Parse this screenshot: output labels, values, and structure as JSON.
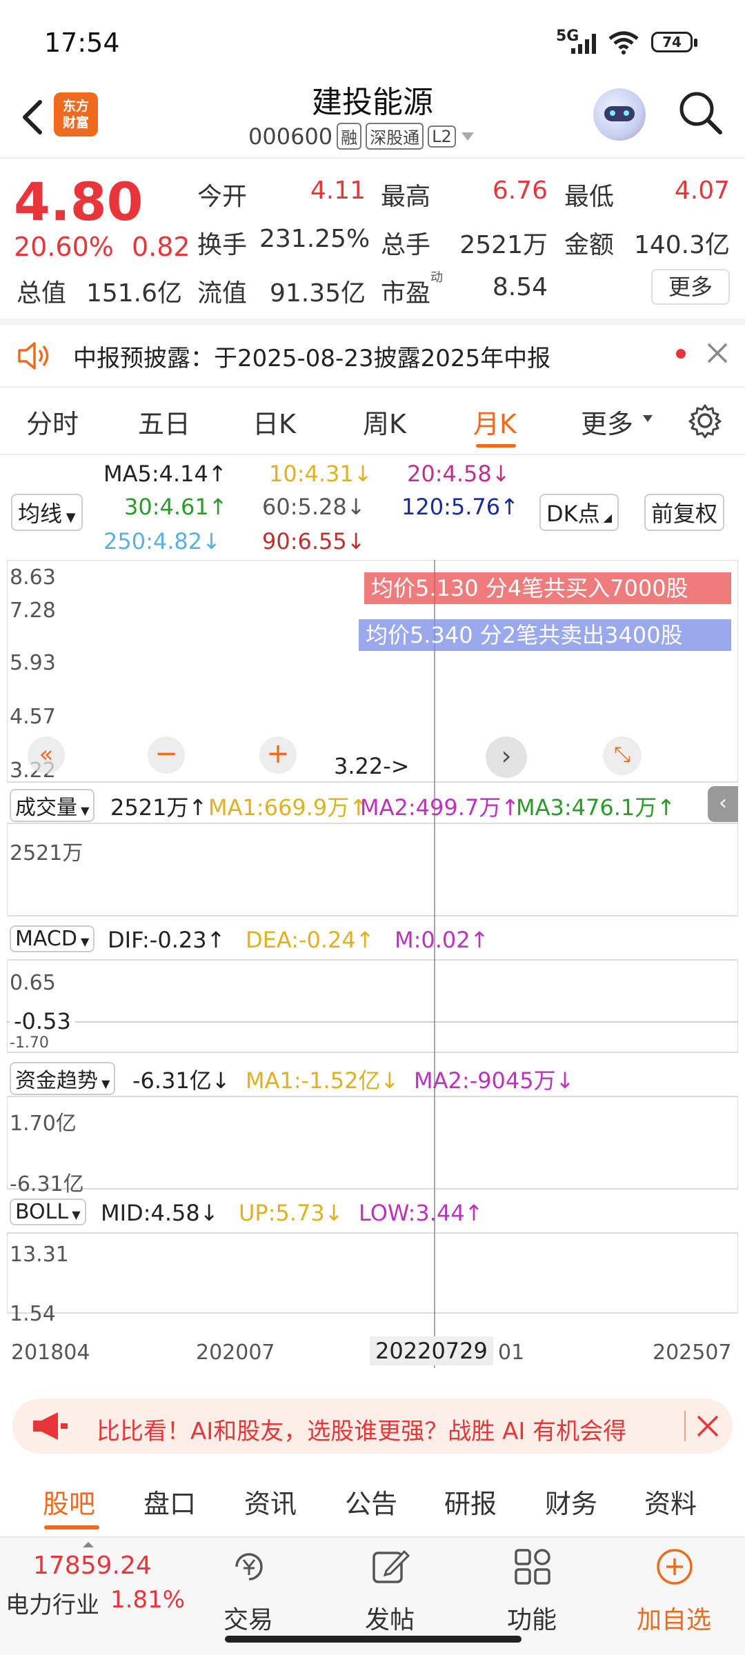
{
  "status_bar": {
    "time": "17:54",
    "network": "5G",
    "battery": "74"
  },
  "header": {
    "back_label": "back",
    "logo_line1": "东方",
    "logo_line2": "财富",
    "title": "建投能源",
    "code": "000600",
    "tags": [
      "融",
      "深股通",
      "L2"
    ]
  },
  "quote": {
    "price": "4.80",
    "change_pct": "20.60%",
    "change_abs": "0.82",
    "rows": [
      [
        {
          "label": "今开",
          "value": "4.11",
          "color": "red"
        },
        {
          "label": "最高",
          "value": "6.76",
          "color": "red"
        },
        {
          "label": "最低",
          "value": "4.07",
          "color": "red"
        }
      ],
      [
        {
          "label": "换手",
          "value": "231.25%",
          "color": "gray"
        },
        {
          "label": "总手",
          "value": "2521万",
          "color": "gray"
        },
        {
          "label": "金额",
          "value": "140.3亿",
          "color": "gray"
        }
      ]
    ],
    "row3": {
      "zongzhi_label": "总值",
      "zongzhi_value": "151.6亿",
      "liuzhi_label": "流值",
      "liuzhi_value": "91.35亿",
      "pe_label": "市盈",
      "pe_sup": "动",
      "pe_value": "8.54"
    },
    "more_label": "更多"
  },
  "notice": {
    "text": "中报预披露：于2025-08-23披露2025年中报"
  },
  "tabs": {
    "items": [
      "分时",
      "五日",
      "日K",
      "周K",
      "月K",
      "更多"
    ],
    "active_index": 4
  },
  "ma_legend": {
    "junxian": "均线",
    "ma5": "MA5:4.14↑",
    "ma10": "10:4.31↓",
    "ma20": "20:4.58↓",
    "ma30": "30:4.61↑",
    "ma60": "60:5.28↓",
    "ma120": "120:5.76↑",
    "ma250": "250:4.82↓",
    "ma90": "90:6.55↓",
    "dk": "DK点",
    "fq": "前复权"
  },
  "chart": {
    "price_labels": [
      "8.63",
      "7.28",
      "5.93",
      "4.57",
      "3.22"
    ],
    "buy_tip": "均价5.130  分4笔共买入7000股",
    "sell_tip": "均价5.340  分2笔共卖出3400股",
    "min_marker": "3.22->",
    "volume": {
      "name": "成交量",
      "value": "2521万↑",
      "ma1": "MA1:669.9万↑",
      "ma2": "MA2:499.7万↑",
      "ma3": "MA3:476.1万↑",
      "scale": "2521万"
    },
    "macd": {
      "name": "MACD",
      "dif": "DIF:-0.23↑",
      "dea": "DEA:-0.24↑",
      "m": "M:0.02↑",
      "top": "0.65",
      "mid": "-0.53",
      "bottom": "-1.70"
    },
    "fund": {
      "name": "资金趋势",
      "value": "-6.31亿↓",
      "ma1": "MA1:-1.52亿↓",
      "ma2": "MA2:-9045万↓",
      "top": "1.70亿",
      "bottom": "-6.31亿"
    },
    "boll": {
      "name": "BOLL",
      "mid": "MID:4.58↓",
      "up": "UP:5.73↓",
      "low": "LOW:3.44↑",
      "top": "13.31",
      "bottom": "1.54"
    },
    "x_labels": [
      "201804",
      "202007",
      "20220729",
      "01",
      "202507"
    ]
  },
  "banner": {
    "text": "比比看！AI和股友，选股谁更强？战胜 AI 有机会得"
  },
  "bottom_tabs": {
    "items": [
      "股吧",
      "盘口",
      "资讯",
      "公告",
      "研报",
      "财务",
      "资料"
    ],
    "active_index": 0
  },
  "footer": {
    "index_value": "17859.24",
    "sector": "电力行业",
    "sector_pct": "1.81%",
    "buttons": [
      "交易",
      "发帖",
      "功能",
      "加自选"
    ]
  },
  "colors": {
    "up": "#e8353a",
    "down": "#2a9a2a",
    "accent": "#f06a1e"
  }
}
